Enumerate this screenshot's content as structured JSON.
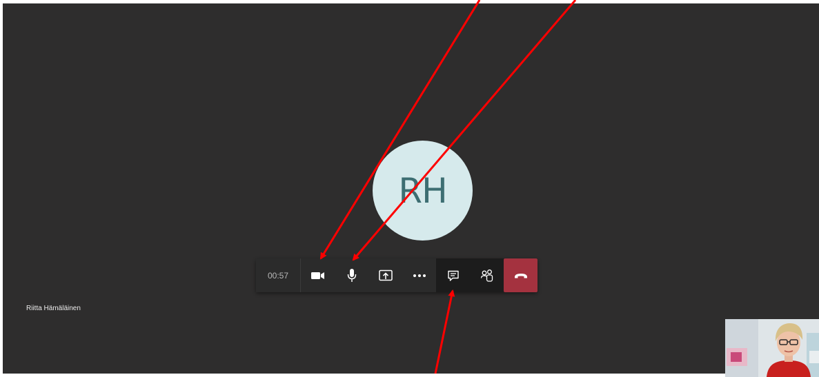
{
  "meeting": {
    "timer": "00:57",
    "participant": {
      "initials": "RH",
      "name": "Riitta Hämäläinen",
      "avatar_bg": "#d6eaec",
      "avatar_fg": "#3d6e72"
    },
    "toolbar": {
      "buttons": [
        {
          "name": "camera-button",
          "icon": "video-camera-icon"
        },
        {
          "name": "mic-button",
          "icon": "microphone-icon"
        },
        {
          "name": "share-button",
          "icon": "share-screen-icon"
        },
        {
          "name": "more-actions-button",
          "icon": "ellipsis-icon"
        },
        {
          "name": "chat-button",
          "icon": "chat-icon"
        },
        {
          "name": "participants-button",
          "icon": "people-icon"
        },
        {
          "name": "hang-up-button",
          "icon": "phone-hangup-icon"
        }
      ],
      "hangup_color": "#a4323f"
    },
    "background_color": "#2e2d2d",
    "annotation_color": "#ff0000"
  }
}
